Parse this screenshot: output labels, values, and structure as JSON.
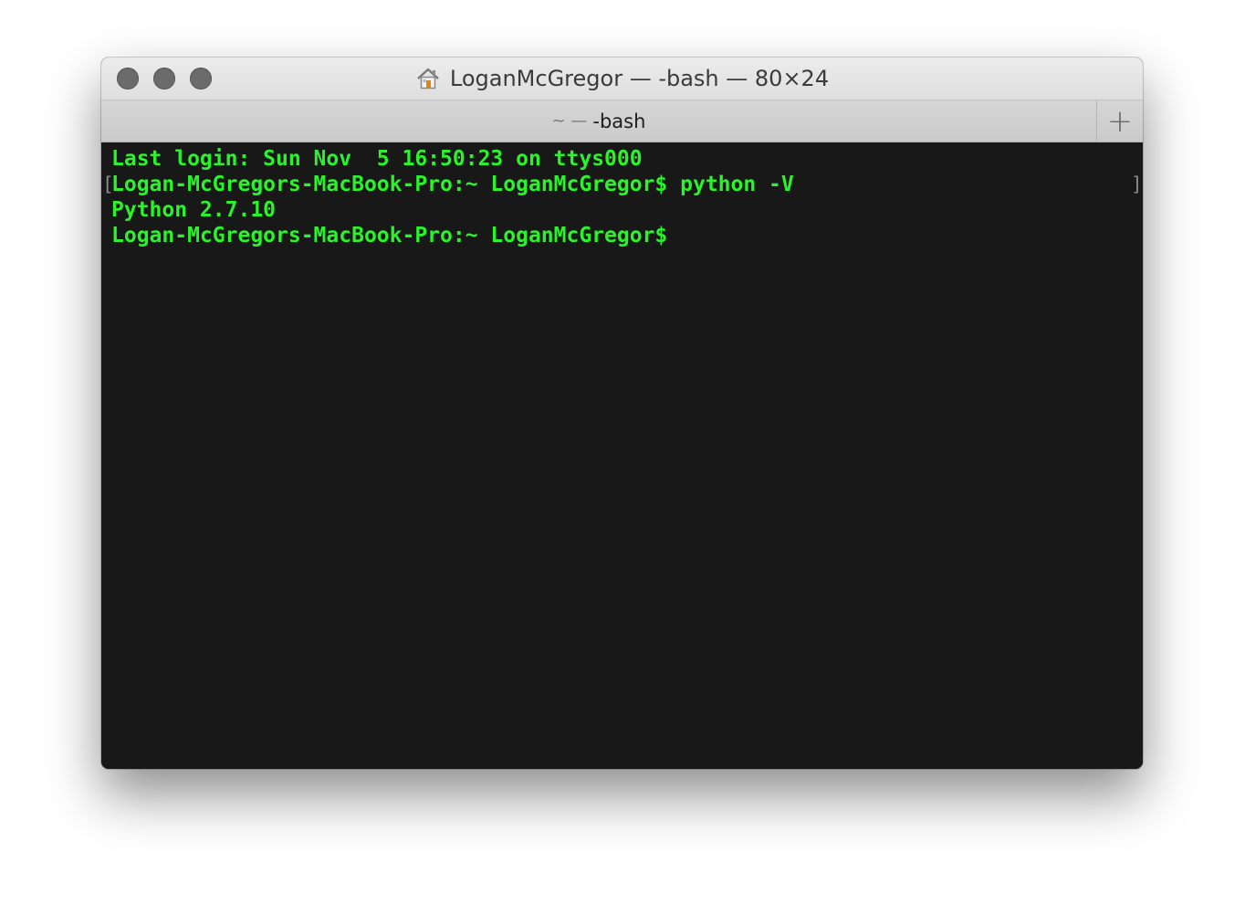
{
  "window": {
    "title": "LoganMcGregor — -bash — 80×24",
    "title_icon": "home-icon",
    "controls": [
      "close",
      "minimize",
      "zoom"
    ]
  },
  "tab": {
    "prefix": "~ —",
    "label": "-bash",
    "new_tab_label": "+"
  },
  "terminal": {
    "lines": [
      "Last login: Sun Nov  5 16:50:23 on ttys000",
      "Logan-McGregors-MacBook-Pro:~ LoganMcGregor$ python -V",
      "Python 2.7.10",
      "Logan-McGregors-MacBook-Pro:~ LoganMcGregor$"
    ],
    "mark_open": "[",
    "mark_close": "]"
  },
  "colors": {
    "terminal_background": "#181818",
    "terminal_text": "#2bf22b",
    "traffic_light": "#6b6b6b"
  }
}
